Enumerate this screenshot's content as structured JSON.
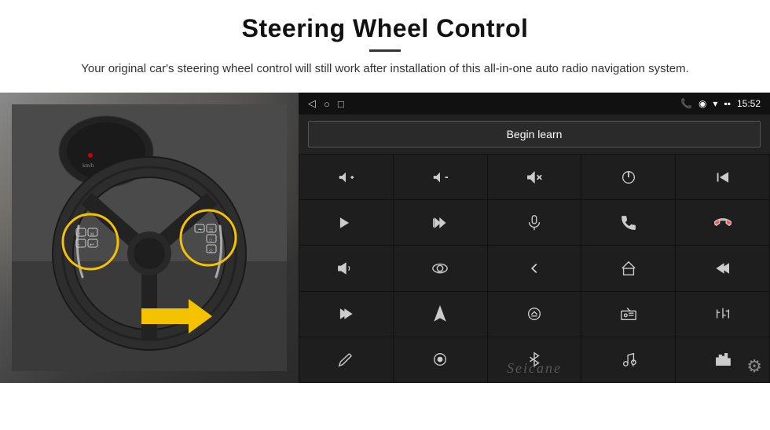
{
  "header": {
    "title": "Steering Wheel Control",
    "divider": true,
    "subtitle": "Your original car's steering wheel control will still work after installation of this all-in-one auto radio navigation system."
  },
  "android_screen": {
    "status_bar": {
      "nav_icons": [
        "◁",
        "○",
        "□"
      ],
      "right_icons": "📞 ◉ ▾ 🔋 15:52",
      "time": "15:52"
    },
    "begin_learn_label": "Begin learn",
    "control_rows": [
      [
        "vol+",
        "vol-",
        "mute",
        "power",
        "prev-track"
      ],
      [
        "skip-next",
        "ff-skip",
        "mic",
        "phone",
        "end-call"
      ],
      [
        "horn",
        "360-cam",
        "back",
        "home",
        "prev"
      ],
      [
        "skip-fwd",
        "navigate",
        "eject",
        "radio",
        "settings-eq"
      ],
      [
        "pen",
        "ok",
        "bluetooth",
        "music-settings",
        "equalizer"
      ]
    ],
    "seicane_label": "Seicane"
  },
  "icons": {
    "gear": "⚙"
  }
}
